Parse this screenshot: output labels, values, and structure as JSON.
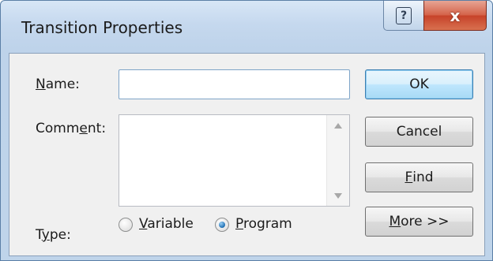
{
  "window": {
    "title": "Transition Properties",
    "help_glyph": "?",
    "close_glyph": "x"
  },
  "form": {
    "name": {
      "label_pre": "",
      "label_mnemonic": "N",
      "label_post": "ame:",
      "value": ""
    },
    "comment": {
      "label_pre": "Comm",
      "label_mnemonic": "e",
      "label_post": "nt:",
      "value": ""
    },
    "type": {
      "label_pre": "T",
      "label_mnemonic": "y",
      "label_post": "pe:",
      "options": [
        {
          "pre": "",
          "mnemonic": "V",
          "post": "ariable",
          "selected": false
        },
        {
          "pre": "",
          "mnemonic": "P",
          "post": "rogram",
          "selected": true
        }
      ]
    }
  },
  "buttons": {
    "ok": {
      "pre": "OK",
      "mnemonic": "",
      "post": ""
    },
    "cancel": {
      "pre": "Cancel",
      "mnemonic": "",
      "post": ""
    },
    "find": {
      "pre": "",
      "mnemonic": "F",
      "post": "ind"
    },
    "more": {
      "pre": "",
      "mnemonic": "M",
      "post": "ore >>"
    }
  },
  "colors": {
    "title_bar": "#c5d8ee",
    "client_bg": "#f0f0f0",
    "close_button": "#c7432a",
    "default_button": "#bee6fd",
    "radio_selected": "#1f6fb3"
  },
  "icons": {
    "help": "question-mark-icon",
    "close": "close-icon",
    "scroll_up": "scroll-up-arrow-icon",
    "scroll_down": "scroll-down-arrow-icon"
  }
}
